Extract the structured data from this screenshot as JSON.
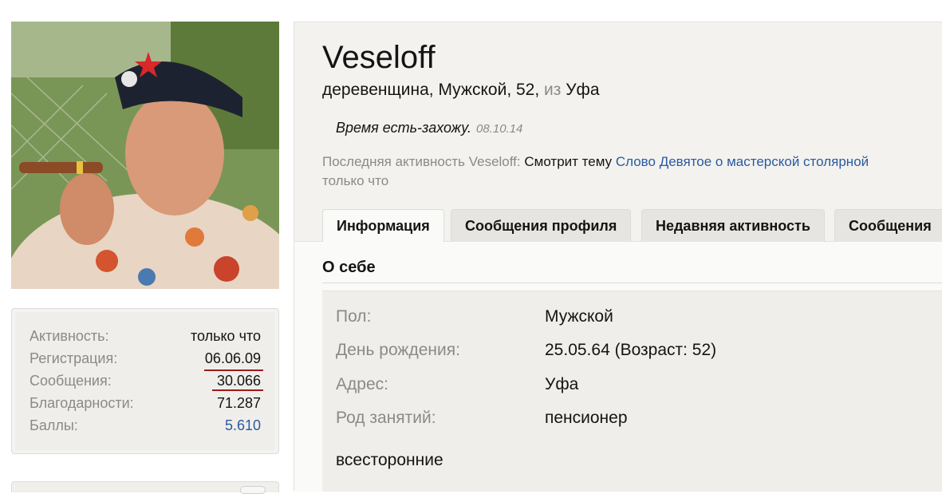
{
  "profile": {
    "username": "Veseloff",
    "title": "деревенщина",
    "gender": "Мужской",
    "age": "52",
    "from_word": "из",
    "city": "Уфа",
    "status_text": "Время есть-захожу.",
    "status_date": "08.10.14",
    "activity_prefix": "Последняя активность Veseloff:",
    "activity_action": "Смотрит тему",
    "activity_link": "Слово Девятое о мастерской столярной",
    "activity_time": "только что"
  },
  "stats": [
    {
      "label": "Активность:",
      "value": "только что",
      "link": false
    },
    {
      "label": "Регистрация:",
      "value": "06.06.09",
      "link": false
    },
    {
      "label": "Сообщения:",
      "value": "30.066",
      "link": false
    },
    {
      "label": "Благодарности:",
      "value": "71.287",
      "link": false
    },
    {
      "label": "Баллы:",
      "value": "5.610",
      "link": true
    }
  ],
  "tabs": [
    {
      "label": "Информация",
      "active": true
    },
    {
      "label": "Сообщения профиля",
      "active": false
    },
    {
      "label": "Недавняя активность",
      "active": false
    },
    {
      "label": "Сообщения",
      "active": false
    }
  ],
  "about": {
    "section_title": "О себе",
    "rows": [
      {
        "label": "Пол:",
        "value": "Мужской"
      },
      {
        "label": "День рождения:",
        "value": "25.05.64 (Возраст: 52)"
      },
      {
        "label": "Адрес:",
        "value": "Уфа"
      },
      {
        "label": "Род занятий:",
        "value": "пенсионер"
      }
    ],
    "text": "всесторонние"
  },
  "colors": {
    "link": "#2b5aa0",
    "muted": "#8a8a8a",
    "underline_red": "#9b1b1b",
    "panel_bg": "#f3f2ef"
  }
}
